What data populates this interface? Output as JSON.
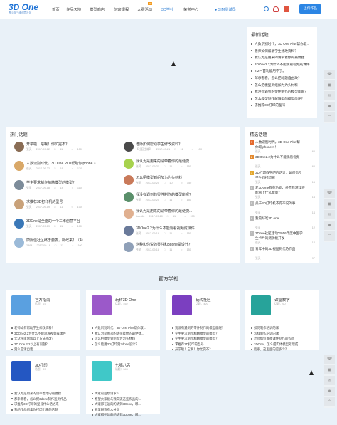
{
  "header": {
    "logo_text": "3D One",
    "logo_sub": "青少年三维创意社区",
    "nav": [
      "首页",
      "作品天地",
      "模型商店",
      "创客课程",
      "大赛活动",
      "3D学社",
      "荣誉中心"
    ],
    "hot_badge": "hot",
    "user_name": "SIM测试员",
    "upload": "上传作品"
  },
  "latest": {
    "title": "最新话题",
    "items": [
      "人数识别时代，3D One Plus帮你取...",
      "老师如何帮助学生修改资料？",
      "我认为是用来的请带着你的最便捷...",
      "3DOne2.2为什么不能观看视频成课件",
      "2.2一首功能用不了。",
      "邮承害看，怎么把标题自由改？",
      "怎么把模型到组加为为头材料",
      "我没有遇到的零件制作的模型能呢？",
      "怎么模型制作解释型的模型能呢？",
      "求推荐3D打印的型号"
    ]
  },
  "hot": {
    "title": "热门话题",
    "left": [
      {
        "t": "开学啦！啥啊！你忙完不？",
        "a": "张灵",
        "d": "2017-09-12",
        "c": "11",
        "v": "150"
      },
      {
        "t": "人数识别时代，3D One Plus帮助你iphone X！",
        "a": "张灵",
        "d": "2017-09-22",
        "c": "18",
        "v": "120"
      },
      {
        "t": "学生要求制作精精模型的模型？",
        "a": "张灵",
        "d": "2017-09-18",
        "c": "14",
        "v": "110"
      },
      {
        "t": "求推荐3D打印机的型号",
        "a": "张灵",
        "d": "2017-09-19",
        "c": "11",
        "v": "100"
      },
      {
        "t": "3DOne是全面的一个三维创意平台",
        "a": "张灵",
        "d": "2017-09-19",
        "c": "11",
        "v": "100"
      },
      {
        "t": "康熙佳社区终于要发，邮政来！（4）",
        "a": "2864",
        "d": "2017-09-18",
        "c": "11",
        "v": "100"
      }
    ],
    "right": [
      {
        "t": "老师如何帮助学生修改资料？",
        "a": "【社区主编】",
        "d": "2017-09-21",
        "c": "11",
        "v": "150"
      },
      {
        "t": "我认为是用来的请带着你的最便捷...",
        "a": "张灵",
        "d": "2017-09-21",
        "c": "11",
        "v": "150"
      },
      {
        "t": "怎么把模型到组加为为头材料",
        "a": "张灵",
        "d": "2017-09-20",
        "c": "10",
        "v": "150"
      },
      {
        "t": "我没有遇到的零件制作的模型能呢？",
        "a": "张灵",
        "d": "2017-09-20",
        "c": "11",
        "v": "150"
      },
      {
        "t": "我认为是用来的请带着你的最便捷...",
        "a": "tparolle",
        "d": "2017-09-20",
        "c": "11",
        "v": "150"
      },
      {
        "t": "3DOne2.2为什么不能观看视频成课件",
        "a": "张灵",
        "d": "2017-09-18",
        "c": "11",
        "v": "150"
      },
      {
        "t": "这种和你说的零件和3done是设计？",
        "a": "张灵",
        "d": "2017-09-18",
        "c": "11",
        "v": "150"
      }
    ]
  },
  "picks": {
    "title": "精选话题",
    "items": [
      {
        "n": "1",
        "t": "人数识别时代，3D One Plus帮",
        "t2": "你取iphone X！",
        "a": "张灵",
        "v": "60"
      },
      {
        "n": "2",
        "t": "3DOne2.2为什么不能观看视频",
        "t2": "",
        "a": "张灵",
        "v": "60"
      },
      {
        "n": "3",
        "t": "3D打印教学吧的话讨：如何指引",
        "t2": "学生们打印啊",
        "a": "张灵",
        "v": "16"
      },
      {
        "n": "4",
        "t": "老3DOne有些功能，经营我游戏还",
        "t2": "能看上什么能量？",
        "a": "张灵",
        "v": "14"
      },
      {
        "n": "5",
        "t": "关于3D打印机不得不说的事",
        "t2": "",
        "a": "张灵",
        "v": "14"
      },
      {
        "n": "6",
        "t": "我的好吃3D one",
        "t2": "",
        "a": "张灵",
        "v": "12"
      },
      {
        "n": "7",
        "t": "3Done社区活动“2016年度中国学",
        "t2": "生卡片的测功能开发",
        "a": "张灵",
        "v": "12"
      },
      {
        "n": "8",
        "t": "青年中的3D视图到代乃作品",
        "t2": "",
        "a": "张灵",
        "v": "97"
      }
    ]
  },
  "academy": {
    "title": "官方学社",
    "cards": [
      {
        "name": "官方指南",
        "sub": "话题：67",
        "items": [
          "老师如何帮助学生修改资料？",
          "3DOne2.2为什么不能观看视频成课件",
          "大众评审增加以上方法修改？",
          "3D One 2.2以上有问题？",
          "到么是请自话"
        ]
      },
      {
        "name": "玩转3D One",
        "sub": "话题：462",
        "items": [
          "人数识别时代，3D One Plus帮你取...",
          "我认为是用来的请带着你的最便捷...",
          "怎么把模型到组加为为头材料",
          "怎么能用3D打印到3done设计？"
        ]
      },
      {
        "name": "玩转社区",
        "sub": "话题：420",
        "items": [
          "我没有遇到的零件制作的模型能呢？",
          "学生要求制作精精模型的模型？",
          "学生要求制作精精模型的模型？",
          "求推荐3D打印的型号",
          "开学啦！它啊！你忙完不？"
        ]
      },
      {
        "name": "课堂教学",
        "sub": "话题：60",
        "items": [
          "如何制作培训的课",
          "怎样制作培训的课",
          "老师如何准备课件制作的作品",
          "3DOne，怎么把实体模型处理成",
          "能家，这里面的是多少？"
        ]
      },
      {
        "name": "3D打印",
        "sub": "话题：67",
        "items": [
          "我认为是用来的请带着你的最便捷...",
          "都幸幕看，怎么把3done制作送到作品",
          "求推荐3D打印的型号什么话进来",
          "我的作品想拿你打印出来的话题"
        ]
      },
      {
        "name": "七嘴八舌",
        "sub": "话题：345",
        "items": [
          "大家的后想请求少",
          "希望大家能与我交流这些作品的...",
          "大家都在运的的请到3Done，哪...",
          "哪里啊我有人分享",
          "大家都在运的的请到3Done，哪..."
        ]
      }
    ]
  },
  "colors": {
    "accent": "#2b7cd3",
    "button": "#2b85e4"
  },
  "rail_icons": [
    "phone-icon",
    "camera-icon",
    "chat-icon",
    "wechat-icon",
    "top-icon"
  ]
}
